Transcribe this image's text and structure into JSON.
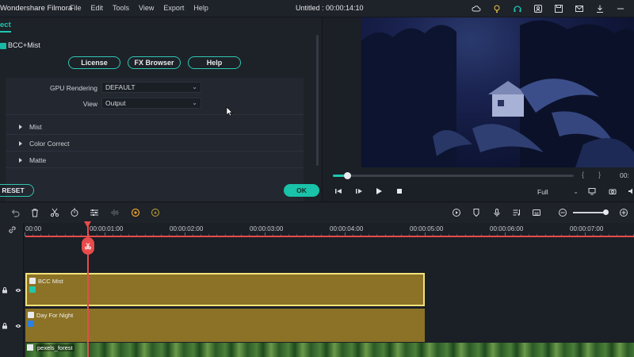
{
  "titlebar": {
    "app_name": "Wondershare Filmora",
    "menu": [
      "File",
      "Edit",
      "Tools",
      "View",
      "Export",
      "Help"
    ],
    "doc_title": "Untitled : 00:00:14:10"
  },
  "effect_panel": {
    "tab": "ect",
    "effect_name": "BCC+Mist",
    "buttons": {
      "license": "License",
      "fx_browser": "FX Browser",
      "help": "Help"
    },
    "gpu_rendering": {
      "label": "GPU Rendering",
      "value": "DEFAULT"
    },
    "view": {
      "label": "View",
      "value": "Output"
    },
    "sections": [
      "Mist",
      "Color Correct",
      "Matte"
    ],
    "reset_label": "RESET",
    "ok_label": "OK"
  },
  "preview": {
    "progress": 0.06,
    "time_partial": "00:",
    "bracket_left": "{",
    "bracket_right": "}",
    "zoom": "Full"
  },
  "timeline": {
    "ruler_labels": [
      "00:00",
      "00:00:01:00",
      "00:00:02:00",
      "00:00:03:00",
      "00:00:04:00",
      "00:00:05:00",
      "00:00:06:00",
      "00:00:07:00"
    ],
    "tracks": [
      {
        "name": "BCC Mist",
        "selected": true
      },
      {
        "name": "Day For Night",
        "selected": false
      },
      {
        "name": "pexels_forest",
        "selected": false
      }
    ],
    "zoom_level": 0.88
  },
  "colors": {
    "accent": "#1ec7b3",
    "clip": "#8b7226",
    "playhead": "#e84b4b",
    "selected_border": "#f2e27a"
  }
}
